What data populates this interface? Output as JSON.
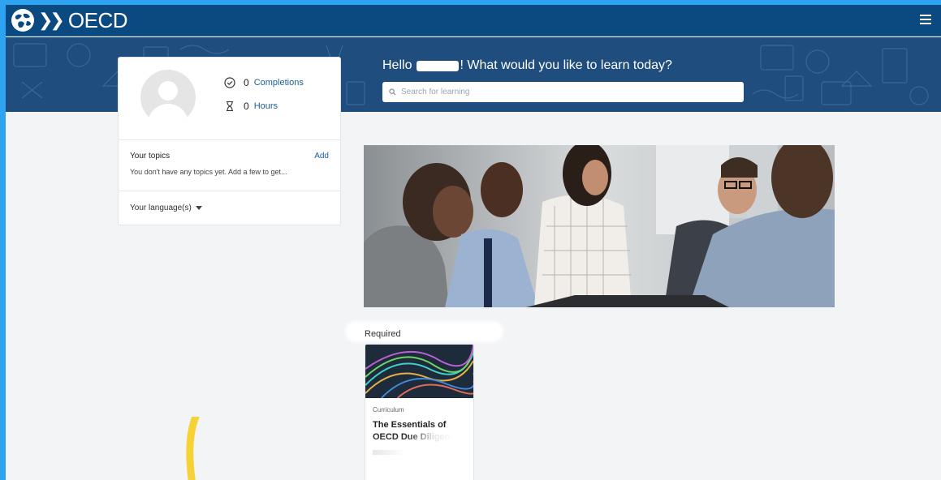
{
  "app": {
    "logo_text": "OECD",
    "logo_chevrons": "❯❯",
    "menu_icon": "hamburger-menu-icon"
  },
  "greeting": {
    "prefix": "Hello ",
    "suffix": "! What would you like to learn today?"
  },
  "search": {
    "placeholder": "Search for learning",
    "value": ""
  },
  "profile": {
    "completions_count": "0",
    "completions_label": "Completions",
    "hours_count": "0",
    "hours_label": "Hours",
    "topics_title": "Your topics",
    "topics_add": "Add",
    "topics_empty": "You don't have any topics yet. Add a few to get...",
    "languages_label": "Your language(s)"
  },
  "sections": [
    {
      "title": "Required",
      "cards": [
        {
          "type": "Curriculum",
          "title": "The Essentials of OECD Due Diligence"
        }
      ]
    }
  ],
  "colors": {
    "topbar": "#0b4a80",
    "banner": "#1f4d7d",
    "link": "#1c5c98",
    "frame_border": "#2ea3f2",
    "doodle": "#f7d237"
  }
}
